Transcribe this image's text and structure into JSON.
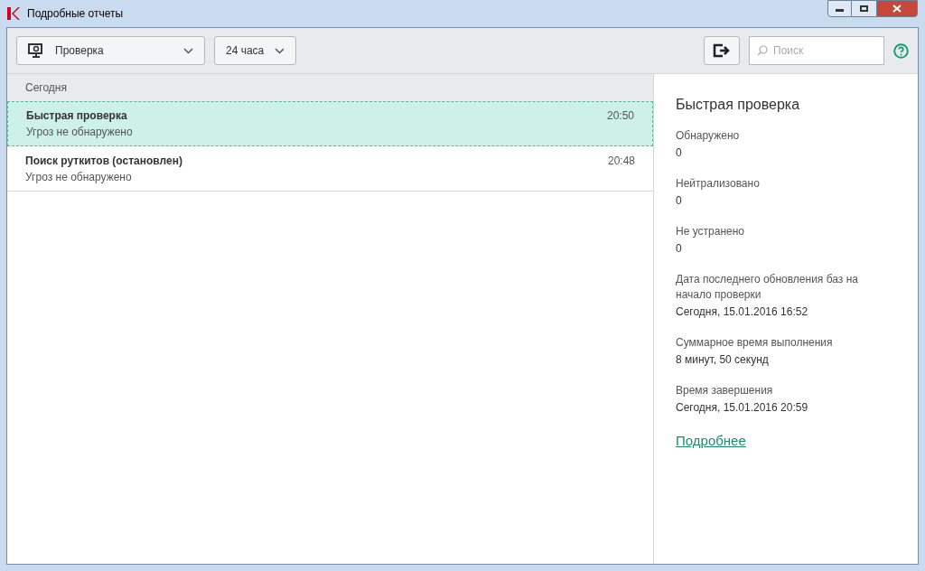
{
  "window": {
    "title": "Подробные отчеты"
  },
  "toolbar": {
    "category": "Проверка",
    "period": "24 часа",
    "search": {
      "placeholder": "Поиск"
    }
  },
  "list": {
    "group": "Сегодня",
    "items": [
      {
        "title": "Быстрая проверка",
        "subtitle": "Угроз не обнаружено",
        "time": "20:50",
        "selected": true
      },
      {
        "title": "Поиск руткитов (остановлен)",
        "subtitle": "Угроз не обнаружено",
        "time": "20:48",
        "selected": false
      }
    ]
  },
  "details": {
    "title": "Быстрая проверка",
    "fields": [
      {
        "label": "Обнаружено",
        "value": "0"
      },
      {
        "label": "Нейтрализовано",
        "value": "0"
      },
      {
        "label": "Не устранено",
        "value": "0"
      },
      {
        "label": "Дата последнего обновления баз на начало проверки",
        "value": "Сегодня, 15.01.2016 16:52"
      },
      {
        "label": "Суммарное время выполнения",
        "value": "8 минут, 50 секунд"
      },
      {
        "label": "Время завершения",
        "value": "Сегодня, 15.01.2016 20:59"
      }
    ],
    "link": "Подробнее"
  }
}
